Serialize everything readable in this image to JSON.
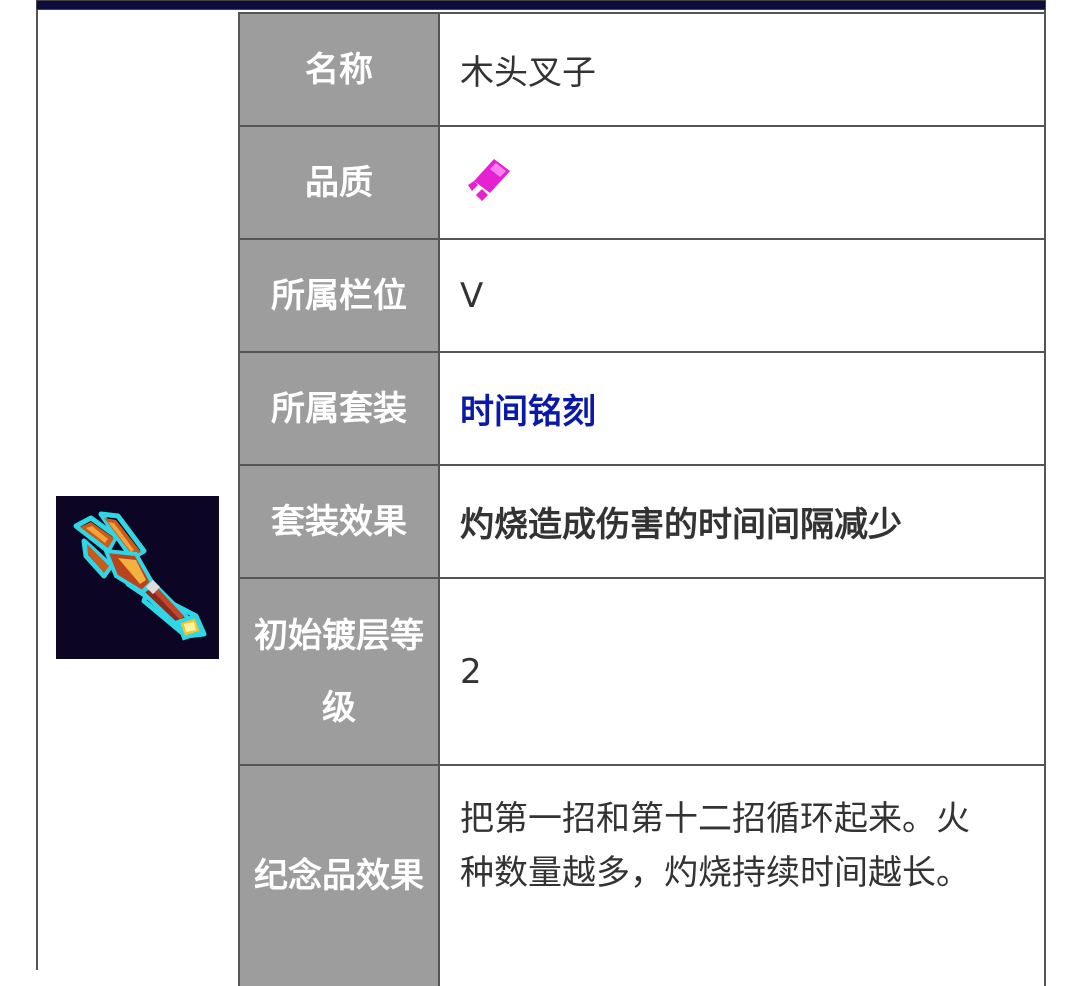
{
  "item": {
    "icon": "wooden-trident-icon",
    "rows": [
      {
        "label": "名称",
        "value": "木头叉子"
      },
      {
        "label": "品质",
        "value_icon": "pink-quality-gem-icon",
        "quality_color": "#e621d1"
      },
      {
        "label": "所属栏位",
        "value": "V"
      },
      {
        "label": "所属套装",
        "value": "时间铭刻",
        "link_color": "#0a1aa8"
      },
      {
        "label": "套装效果",
        "value": "灼烧造成伤害的时间间隔减少"
      },
      {
        "label": "初始镀层等级",
        "value": "2"
      },
      {
        "label": "纪念品效果",
        "value": "把第一招和第十二招循环起来。火种数量越多，灼烧持续时间越长。"
      }
    ]
  },
  "colors": {
    "label_bg": "#9d9d9d",
    "header_bar": "#0e0e3e",
    "icon_bg": "#0c0523"
  }
}
